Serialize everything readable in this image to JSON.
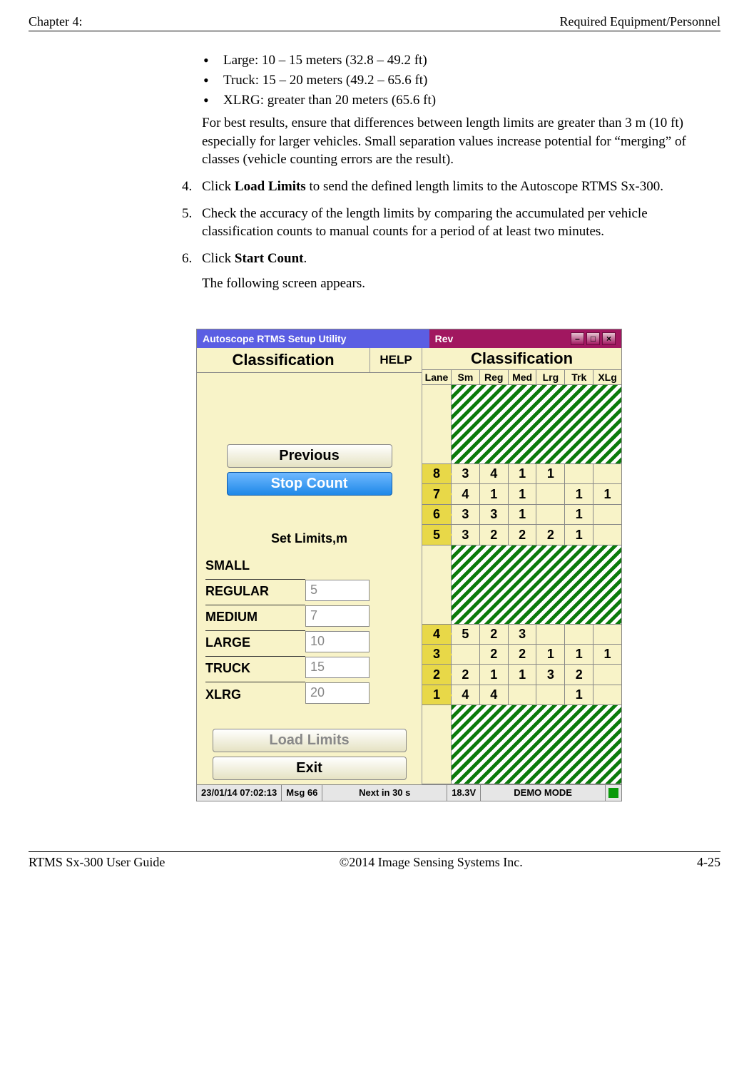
{
  "header": {
    "left": "Chapter 4:",
    "right": "Required Equipment/Personnel"
  },
  "bullets": [
    "Large: 10 – 15 meters (32.8 – 49.2 ft)",
    "Truck: 15 – 20 meters (49.2 – 65.6 ft)",
    "XLRG: greater than 20 meters (65.6 ft)"
  ],
  "paragraph1": "For best results, ensure that differences between length limits are greater than 3 m (10 ft) especially for larger vehicles. Small separation values increase potential for “merging” of classes (vehicle counting errors are the result).",
  "step4": {
    "pre": "Click ",
    "bold": "Load Limits",
    "post": " to send the defined length limits to the Autoscope RTMS Sx-300."
  },
  "step5": "Check the accuracy of the length limits by comparing the accumulated per vehicle classification counts to manual counts for a period of at least two minutes.",
  "step6": {
    "pre": "Click ",
    "bold": "Start Count",
    "post": "."
  },
  "step6_note": "The following screen appears.",
  "app": {
    "titlebar_left": "Autoscope RTMS Setup Utility",
    "titlebar_right": "Rev",
    "left_header": "Classification",
    "help": "HELP",
    "right_header": "Classification",
    "columns": [
      "Lane",
      "Sm",
      "Reg",
      "Med",
      "Lrg",
      "Trk",
      "XLg"
    ],
    "btn_previous": "Previous",
    "btn_stopcount": "Stop Count",
    "set_limits_label": "Set Limits,m",
    "limits": [
      {
        "label": "SMALL",
        "value": ""
      },
      {
        "label": "REGULAR",
        "value": "5"
      },
      {
        "label": "MEDIUM",
        "value": "7"
      },
      {
        "label": "LARGE",
        "value": "10"
      },
      {
        "label": "TRUCK",
        "value": "15"
      },
      {
        "label": "XLRG",
        "value": "20"
      }
    ],
    "btn_loadlimits": "Load Limits",
    "btn_exit": "Exit",
    "rows": [
      {
        "type": "hatch"
      },
      {
        "lane": "8",
        "cells": [
          "3",
          "4",
          "1",
          "1",
          "",
          ""
        ]
      },
      {
        "lane": "7",
        "cells": [
          "4",
          "1",
          "1",
          "",
          "1",
          "1"
        ]
      },
      {
        "lane": "6",
        "cells": [
          "3",
          "3",
          "1",
          "",
          "1",
          ""
        ]
      },
      {
        "lane": "5",
        "cells": [
          "3",
          "2",
          "2",
          "2",
          "1",
          ""
        ]
      },
      {
        "type": "hatch"
      },
      {
        "lane": "4",
        "cells": [
          "5",
          "2",
          "3",
          "",
          "",
          ""
        ]
      },
      {
        "lane": "3",
        "cells": [
          "",
          "2",
          "2",
          "1",
          "1",
          "1"
        ]
      },
      {
        "lane": "2",
        "cells": [
          "2",
          "1",
          "1",
          "3",
          "2",
          ""
        ]
      },
      {
        "lane": "1",
        "cells": [
          "4",
          "4",
          "",
          "",
          "1",
          ""
        ]
      },
      {
        "type": "hatch"
      }
    ],
    "status": {
      "time": "23/01/14 07:02:13",
      "msg": "Msg 66",
      "next": "Next in 30 s",
      "volt": "18.3V",
      "mode": "DEMO MODE"
    }
  },
  "footer": {
    "left": "RTMS Sx-300 User Guide",
    "center": "©2014 Image Sensing Systems Inc.",
    "right": "4-25"
  }
}
